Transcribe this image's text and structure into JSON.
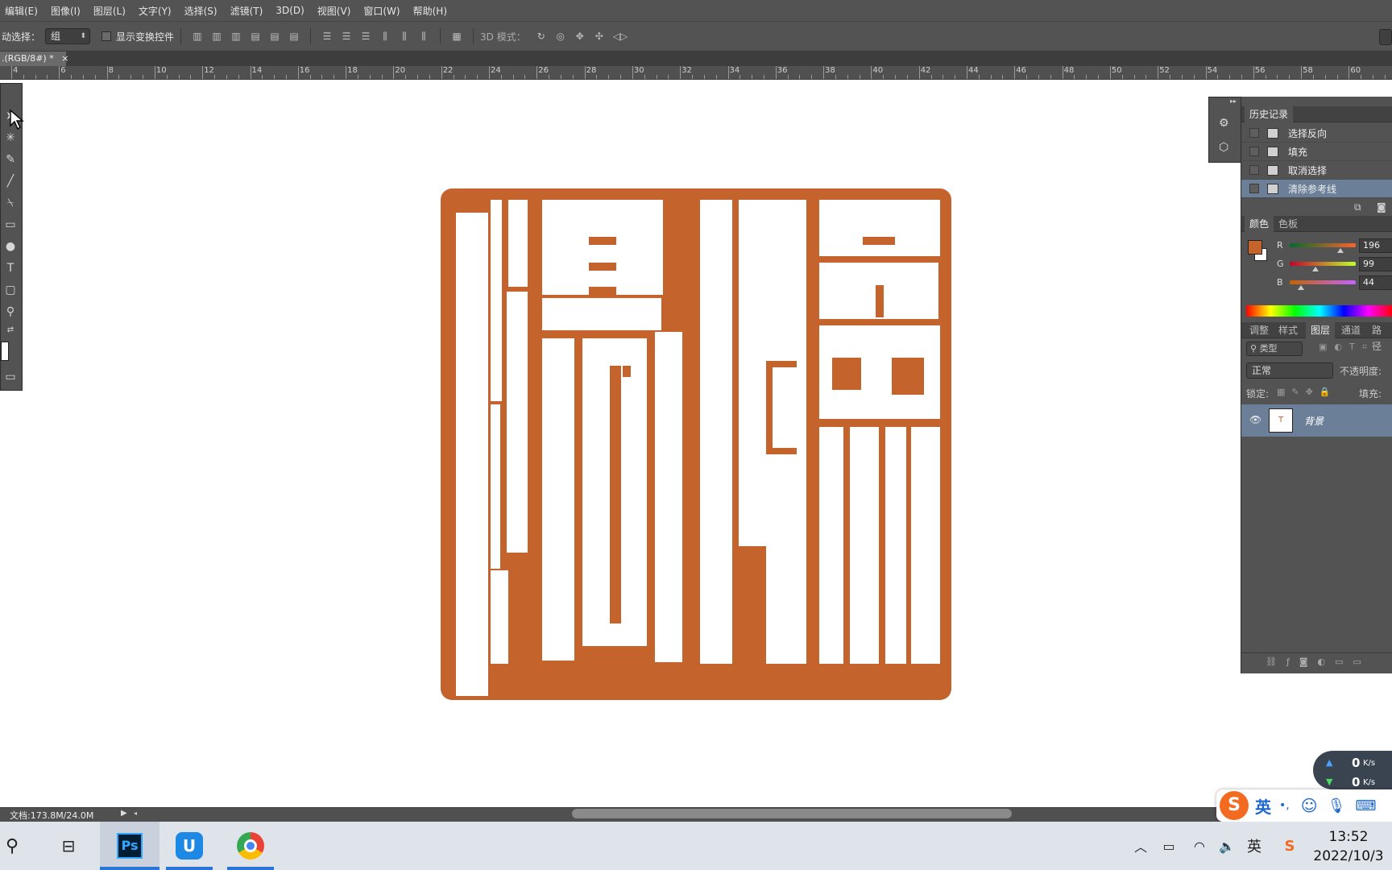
{
  "menu": [
    "编辑(E)",
    "图像(I)",
    "图层(L)",
    "文字(Y)",
    "选择(S)",
    "滤镜(T)",
    "3D(D)",
    "视图(V)",
    "窗口(W)",
    "帮助(H)"
  ],
  "options": {
    "auto_select_label": "动选择：",
    "auto_select_value": "组",
    "show_transform_label": "显示变换控件",
    "mode_3d_label": "3D 模式："
  },
  "document": {
    "tab_title": ".(RGB/8#) *",
    "close_glyph": "×"
  },
  "ruler_ticks": [
    "4",
    "6",
    "8",
    "10",
    "12",
    "14",
    "16",
    "18",
    "20",
    "22",
    "24",
    "26",
    "28",
    "30",
    "32",
    "34",
    "36",
    "38",
    "40",
    "42",
    "44",
    "46",
    "48",
    "50",
    "52",
    "54",
    "56",
    "58",
    "60"
  ],
  "tools": [
    "arrow",
    "wand",
    "eyedropper",
    "brush",
    "stamp",
    "gradient",
    "dodge",
    "T",
    "shape",
    "zoom"
  ],
  "history": {
    "tab": "历史记录",
    "items": [
      {
        "label": "选择反向",
        "active": false
      },
      {
        "label": "填充",
        "active": false
      },
      {
        "label": "取消选择",
        "active": false
      },
      {
        "label": "清除参考线",
        "active": true
      }
    ]
  },
  "color_panel": {
    "tabs": [
      "颜色",
      "色板"
    ],
    "foreground": "#c4632c",
    "channels": [
      {
        "name": "R",
        "value": "196"
      },
      {
        "name": "G",
        "value": "99"
      },
      {
        "name": "B",
        "value": "44"
      }
    ]
  },
  "layers_panel": {
    "tabs": [
      "调整",
      "样式",
      "图层",
      "通道",
      "路径"
    ],
    "filter_label": "类型",
    "blend_mode": "正常",
    "opacity_label": "不透明度:",
    "lock_label": "锁定:",
    "fill_label": "填充:",
    "layer_name": "背景",
    "thumb_mark": "T"
  },
  "status": {
    "doc_info": "文档:173.8M/24.0M"
  },
  "network": {
    "up": "0",
    "down": "0",
    "unit": "K/s"
  },
  "ime": {
    "lang": "英",
    "punct": "•,"
  },
  "tray": {
    "lang": "英"
  },
  "taskbar": {
    "ps_label": "Ps"
  },
  "clock": {
    "time": "13:52",
    "date": "2022/10/3"
  },
  "colors": {
    "seal": "#c5632c",
    "ui_dark": "#535353"
  }
}
